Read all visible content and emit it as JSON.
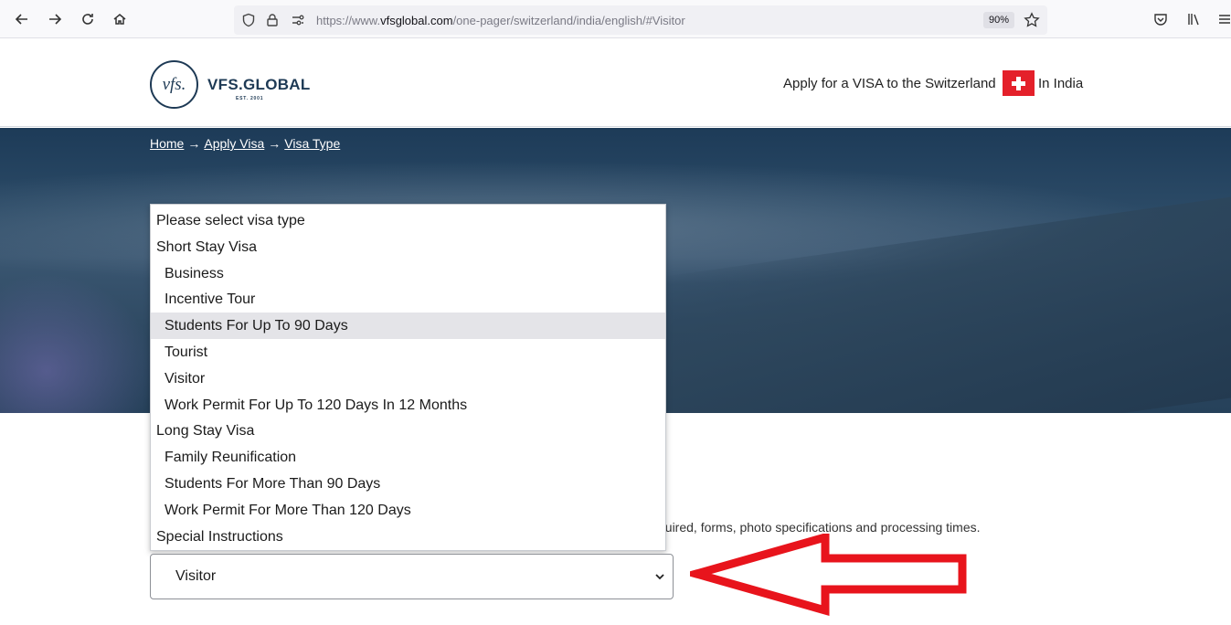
{
  "browser": {
    "url_prefix": "https://www.",
    "url_host": "vfsglobal.com",
    "url_path": "/one-pager/switzerland/india/english/#Visitor",
    "zoom": "90%"
  },
  "header": {
    "logo_monogram": "vfs.",
    "logo_name": "VFS.GLOBAL",
    "logo_est": "EST. 2001",
    "title": "Apply for a VISA to the Switzerland",
    "country": "In India"
  },
  "breadcrumb": {
    "home": "Home",
    "apply": "Apply Visa",
    "current": "Visa Type",
    "separator": "→"
  },
  "visa_dropdown": {
    "options": [
      {
        "label": "Please select visa type",
        "kind": "group"
      },
      {
        "label": "Short Stay Visa",
        "kind": "group"
      },
      {
        "label": "Business",
        "kind": "child"
      },
      {
        "label": "Incentive Tour",
        "kind": "child"
      },
      {
        "label": "Students For Up To 90 Days",
        "kind": "child",
        "highlighted": true
      },
      {
        "label": "Tourist",
        "kind": "child"
      },
      {
        "label": "Visitor",
        "kind": "child"
      },
      {
        "label": "Work Permit For Up To 120 Days In 12 Months",
        "kind": "child"
      },
      {
        "label": "Long Stay Visa",
        "kind": "group"
      },
      {
        "label": "Family Reunification",
        "kind": "child"
      },
      {
        "label": "Students For More Than 90 Days",
        "kind": "child"
      },
      {
        "label": "Work Permit For More Than 120 Days",
        "kind": "child"
      },
      {
        "label": "Special Instructions",
        "kind": "group"
      }
    ],
    "selected_value": "Visitor"
  },
  "description_fragment": "quired, forms, photo specifications and processing times.",
  "colors": {
    "brand_navy": "#1e3a55",
    "swiss_red": "#e4202a",
    "annotation_red": "#e8141c",
    "highlight": "#e4e4e8"
  }
}
